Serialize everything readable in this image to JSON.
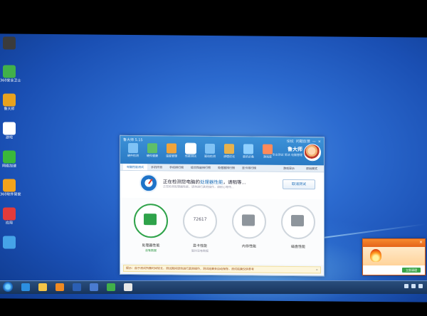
{
  "app": {
    "title": "鲁大师 5.15",
    "controls": [
      "论坛",
      "问题反馈",
      "—",
      "×"
    ],
    "brand": "鲁大师",
    "brand_sub": "专业测试  简洁 电脑管理",
    "nav": [
      {
        "label": "硬件检测",
        "icon": "monitor-icon",
        "color": "#7fc2f5"
      },
      {
        "label": "硬件健康",
        "icon": "chip-icon",
        "color": "#5fbf6a"
      },
      {
        "label": "温度管理",
        "icon": "thermometer-icon",
        "color": "#f0a43a"
      },
      {
        "label": "性能测试",
        "icon": "speedometer-icon",
        "color": "#ffffff",
        "active": true
      },
      {
        "label": "驱动检测",
        "icon": "driver-icon",
        "color": "#7fc2f5"
      },
      {
        "label": "清理优化",
        "icon": "broom-icon",
        "color": "#e8b24c"
      },
      {
        "label": "装机必备",
        "icon": "box-icon",
        "color": "#8fd0ff"
      },
      {
        "label": "游戏库",
        "icon": "gamepad-icon",
        "color": "#ff8a5a"
      }
    ],
    "subtabs": [
      "电脑性能测试",
      "手机评测",
      "手机排行榜",
      "综合性能排行榜",
      "处理器排行榜",
      "显卡排行榜"
    ],
    "subtabs_right": [
      "游戏显示",
      "原始模式"
    ],
    "status": {
      "title_prefix": "正在检测您电脑的",
      "title_highlight": "处理器性能",
      "title_suffix": "，请稍等...",
      "subtitle": "正在检测处理器性能，请勿进行其他操作，请耐心等待..."
    },
    "cancel_label": "取消测试",
    "cards": [
      {
        "title": "处理器性能",
        "sub": "没有数据",
        "icon": "monitor-check-icon",
        "active": true
      },
      {
        "title": "显卡性能",
        "sub": "暂时没有数据",
        "value": "72617",
        "icon": "cube-icon"
      },
      {
        "title": "内存性能",
        "sub": "",
        "icon": "ram-icon"
      },
      {
        "title": "磁盘性能",
        "sub": "",
        "icon": "disk-icon"
      }
    ],
    "tip": "提示：由于测试所需时间较长，测试期间请勿进行其他操作，测试结果会自动保存，测试结果仅供参考"
  },
  "desktop_icons": [
    {
      "label": "",
      "color": "#3b3b3b"
    },
    {
      "label": "360安全卫士",
      "color": "#41b04a"
    },
    {
      "label": "鲁大师",
      "color": "#e8a21e"
    },
    {
      "label": "游戏",
      "color": "#ffffff"
    },
    {
      "label": "网络加速",
      "color": "#3ab83a"
    },
    {
      "label": "360软件管家",
      "color": "#f3a31c"
    },
    {
      "label": "应用",
      "color": "#e23b3b"
    },
    {
      "label": "",
      "color": "#45a3e8"
    }
  ],
  "popup": {
    "close": "×",
    "button": "立即清理"
  },
  "taskbar": {
    "icons": [
      {
        "icon": "ie-icon",
        "color": "#2c8fe0"
      },
      {
        "icon": "folder-icon",
        "color": "#f3c447"
      },
      {
        "icon": "media-icon",
        "color": "#f08a22"
      },
      {
        "icon": "word-icon",
        "color": "#2b5fb4"
      },
      {
        "icon": "app-icon",
        "color": "#4a7bd0"
      },
      {
        "icon": "360-icon",
        "color": "#41b04a"
      },
      {
        "icon": "ludashi-icon",
        "color": "#e7e7e7"
      }
    ]
  }
}
